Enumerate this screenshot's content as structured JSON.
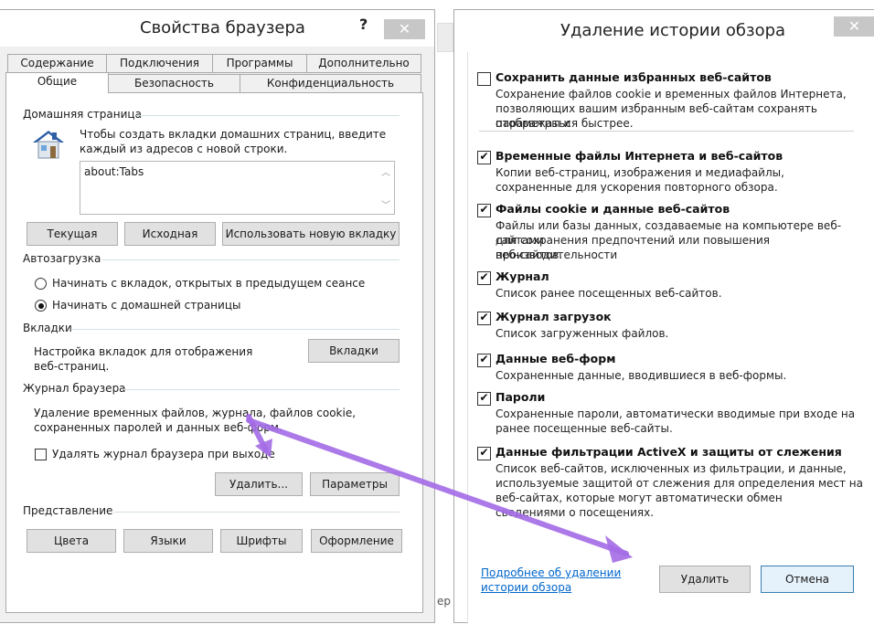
{
  "left": {
    "title": "Свойства браузера",
    "help": "?",
    "close": "✕",
    "tabs_row1": [
      "Содержание",
      "Подключения",
      "Программы",
      "Дополнительно"
    ],
    "tabs_row2": [
      "Общие",
      "Безопасность",
      "Конфиденциальность"
    ],
    "home": {
      "section": "Домашняя страница",
      "desc1": "Чтобы создать вкладки домашних страниц, введите",
      "desc2": "каждый из адресов с новой строки.",
      "value": "about:Tabs",
      "btn_current": "Текущая",
      "btn_default": "Исходная",
      "btn_newtab": "Использовать новую вкладку"
    },
    "startup": {
      "section": "Автозагрузка",
      "opt1": "Начинать с вкладок, открытых в предыдущем сеансе",
      "opt2": "Начинать с домашней страницы",
      "selected": 2
    },
    "tabs_section": {
      "section": "Вкладки",
      "desc1": "Настройка вкладок для отображения",
      "desc2": "веб-страниц.",
      "btn": "Вкладки"
    },
    "history": {
      "section": "Журнал браузера",
      "desc1": "Удаление временных файлов, журнала, файлов cookie,",
      "desc2": "сохраненных паролей и данных веб-форм.",
      "checkbox": "Удалять журнал браузера при выходе",
      "btn_delete": "Удалить...",
      "btn_params": "Параметры"
    },
    "appearance": {
      "section": "Представление",
      "btn_colors": "Цвета",
      "btn_langs": "Языки",
      "btn_fonts": "Шрифты",
      "btn_design": "Оформление"
    },
    "partial_text": "ер"
  },
  "right": {
    "title": "Удаление истории обзора",
    "close": "✕",
    "items": [
      {
        "title": "Сохранить данные избранных веб-сайтов",
        "checked": false,
        "desc": [
          "Сохранение файлов cookie и временных файлов Интернета,",
          "позволяющих вашим избранным веб-сайтам сохранять параметры и",
          "отображаться быстрее."
        ]
      },
      {
        "title": "Временные файлы Интернета и веб-сайтов",
        "checked": true,
        "desc": [
          "Копии веб-страниц, изображения и медиафайлы,",
          "сохраненные для ускорения повторного обзора."
        ]
      },
      {
        "title": "Файлы cookie и данные веб-сайтов",
        "checked": true,
        "desc": [
          "Файлы или базы данных, создаваемые на компьютере веб-сайтами",
          "для сохранения предпочтений или повышения производительности",
          "веб-сайтов."
        ]
      },
      {
        "title": "Журнал",
        "checked": true,
        "desc": [
          "Список ранее посещенных веб-сайтов."
        ]
      },
      {
        "title": "Журнал загрузок",
        "checked": true,
        "desc": [
          "Список загруженных файлов."
        ]
      },
      {
        "title": "Данные веб-форм",
        "checked": true,
        "desc": [
          "Сохраненные данные, вводившиеся в веб-формы."
        ]
      },
      {
        "title": "Пароли",
        "checked": true,
        "desc": [
          "Сохраненные пароли, автоматически вводимые при входе на",
          "ранее посещенные веб-сайты."
        ]
      },
      {
        "title": "Данные фильтрации ActiveX и защиты от слежения",
        "checked": true,
        "desc": [
          "Список веб-сайтов, исключенных из фильтрации, и данные,",
          "используемые защитой от слежения для определения мест на",
          "веб-сайтах, которые могут автоматически обмен",
          "сведениями о посещениях."
        ]
      }
    ],
    "link1": "Подробнее об удалении",
    "link2": "истории обзора",
    "btn_delete": "Удалить",
    "btn_cancel": "Отмена"
  },
  "colors": {
    "accent": "#a46be6",
    "link": "#0066cc",
    "close_bg": "#c7c7c7"
  }
}
